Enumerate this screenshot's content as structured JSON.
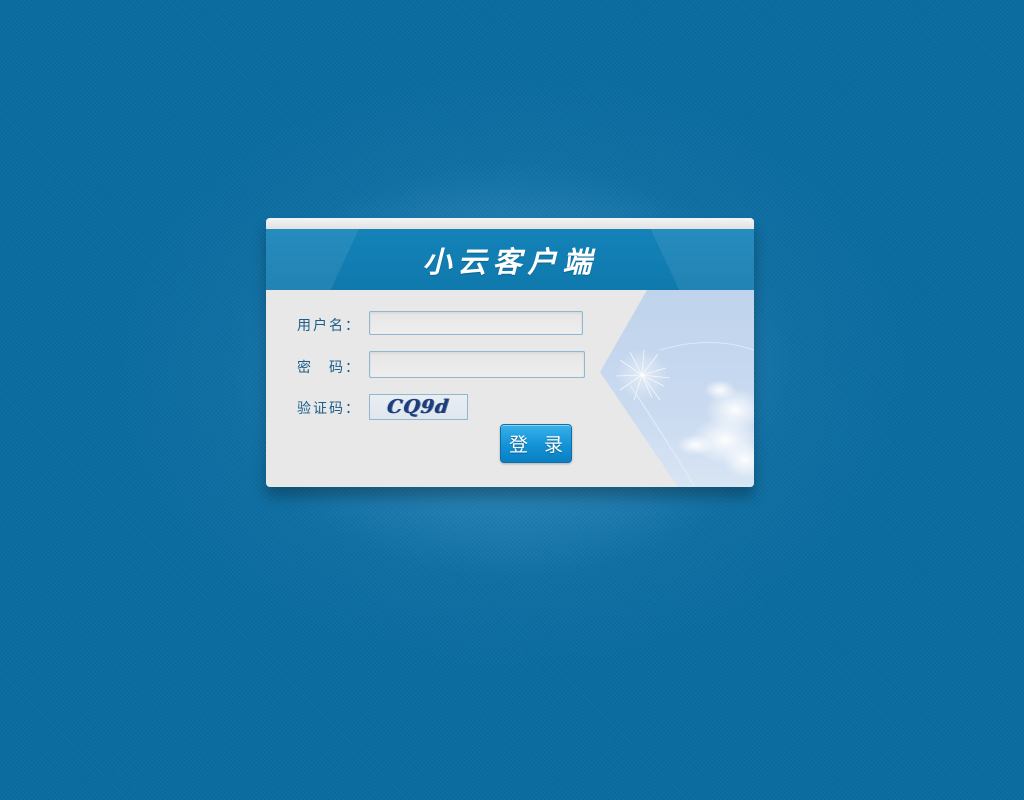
{
  "app": {
    "title": "小云客户端"
  },
  "form": {
    "username_label": "用户名：",
    "username_value": "",
    "password_label": "密　码：",
    "password_value": "",
    "captcha_label": "验证码：",
    "captcha_text": "CQ9d",
    "login_label": "登 录"
  },
  "colors": {
    "background": "#0a6ba0",
    "header": "#1180b6",
    "label": "#1b5e8a",
    "button": "#1595d8"
  }
}
